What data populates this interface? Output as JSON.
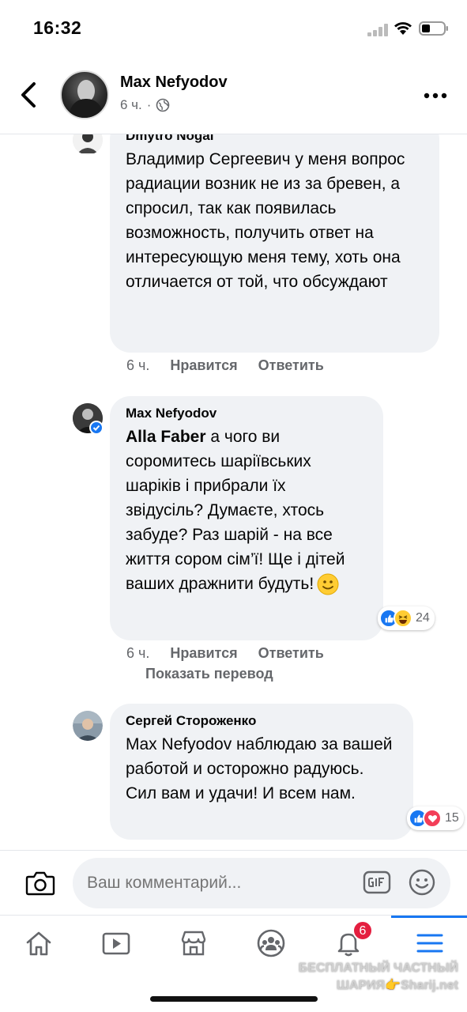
{
  "status_bar": {
    "time": "16:32"
  },
  "header": {
    "author": "Max Nefyodov",
    "time": "6 ч.",
    "separator": "·"
  },
  "comments": [
    {
      "author": "Dmytro Nogai",
      "text": "Владимир Сергеевич у меня вопрос радиации возник не из за бревен, а спросил, так как появилась возможность, получить ответ на интересующую меня тему, хоть она отличается от той, что обсуждают",
      "time": "6 ч.",
      "like": "Нравится",
      "reply": "Ответить"
    },
    {
      "author": "Max Nefyodov",
      "mention": "Alla Faber",
      "text": " а чого ви соромитесь шаріївських шаріків і прибрали їх звідусіль? Думаєте, хтось забуде? Раз шарій - на все життя сором сім’ї! Ще і дітей ваших дражнити будуть!",
      "time": "6 ч.",
      "like": "Нравится",
      "reply": "Ответить",
      "translate": "Показать перевод",
      "reaction_count": "24"
    },
    {
      "author": "Сергей Стороженко",
      "text": "Max Nefyodov наблюдаю за вашей работой и осторожно радуюсь. Сил вам и удачи! И всем нам.",
      "reaction_count": "15"
    }
  ],
  "composer": {
    "placeholder": "Ваш комментарий..."
  },
  "bottom_nav": {
    "items": [
      "home-icon",
      "watch-icon",
      "marketplace-icon",
      "groups-icon",
      "notifications-icon",
      "menu-icon"
    ],
    "notification_count": "6"
  },
  "watermark": {
    "line1": "БЕСПЛАТНЫЙ ЧАСТНЫЙ",
    "line2": "ШАРИЯ👉Sharij.net"
  },
  "colors": {
    "accent": "#1877f2",
    "bubble": "#f0f2f5",
    "secondary_text": "#65676b",
    "badge": "#e41e3f"
  }
}
